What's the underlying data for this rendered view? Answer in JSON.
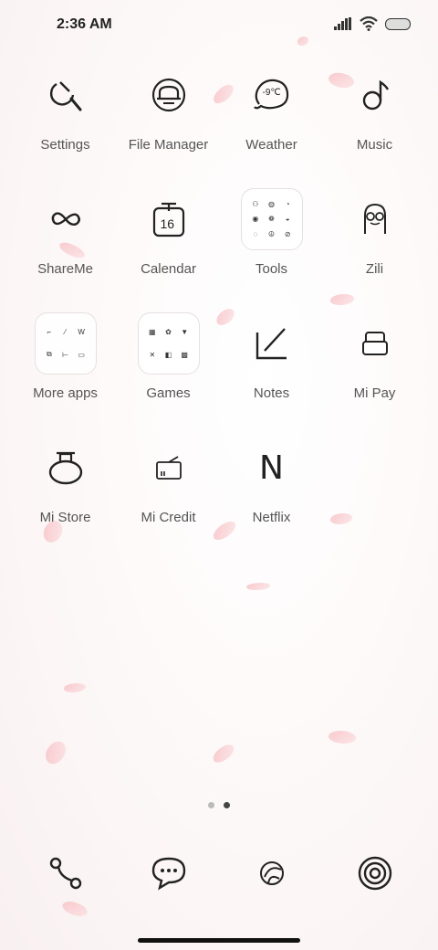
{
  "status_bar": {
    "time": "2:36 AM"
  },
  "apps": [
    {
      "label": "Settings",
      "icon": "settings-icon"
    },
    {
      "label": "File Manager",
      "icon": "file-manager-icon"
    },
    {
      "label": "Weather",
      "icon": "weather-icon",
      "icon_text": "-9℃"
    },
    {
      "label": "Music",
      "icon": "music-icon"
    },
    {
      "label": "ShareMe",
      "icon": "shareme-icon"
    },
    {
      "label": "Calendar",
      "icon": "calendar-icon",
      "icon_text": "16"
    },
    {
      "label": "Tools",
      "icon": "tools-folder-icon"
    },
    {
      "label": "Zili",
      "icon": "zili-icon"
    },
    {
      "label": "More apps",
      "icon": "more-apps-folder-icon"
    },
    {
      "label": "Games",
      "icon": "games-folder-icon"
    },
    {
      "label": "Notes",
      "icon": "notes-icon"
    },
    {
      "label": "Mi Pay",
      "icon": "mi-pay-icon"
    },
    {
      "label": "Mi Store",
      "icon": "mi-store-icon"
    },
    {
      "label": "Mi Credit",
      "icon": "mi-credit-icon"
    },
    {
      "label": "Netflix",
      "icon": "netflix-icon",
      "icon_text": "N"
    }
  ],
  "page_indicator": {
    "count": 2,
    "active": 2
  },
  "dock": [
    {
      "icon": "phone-icon"
    },
    {
      "icon": "messages-icon"
    },
    {
      "icon": "browser-icon"
    },
    {
      "icon": "camera-icon"
    }
  ]
}
